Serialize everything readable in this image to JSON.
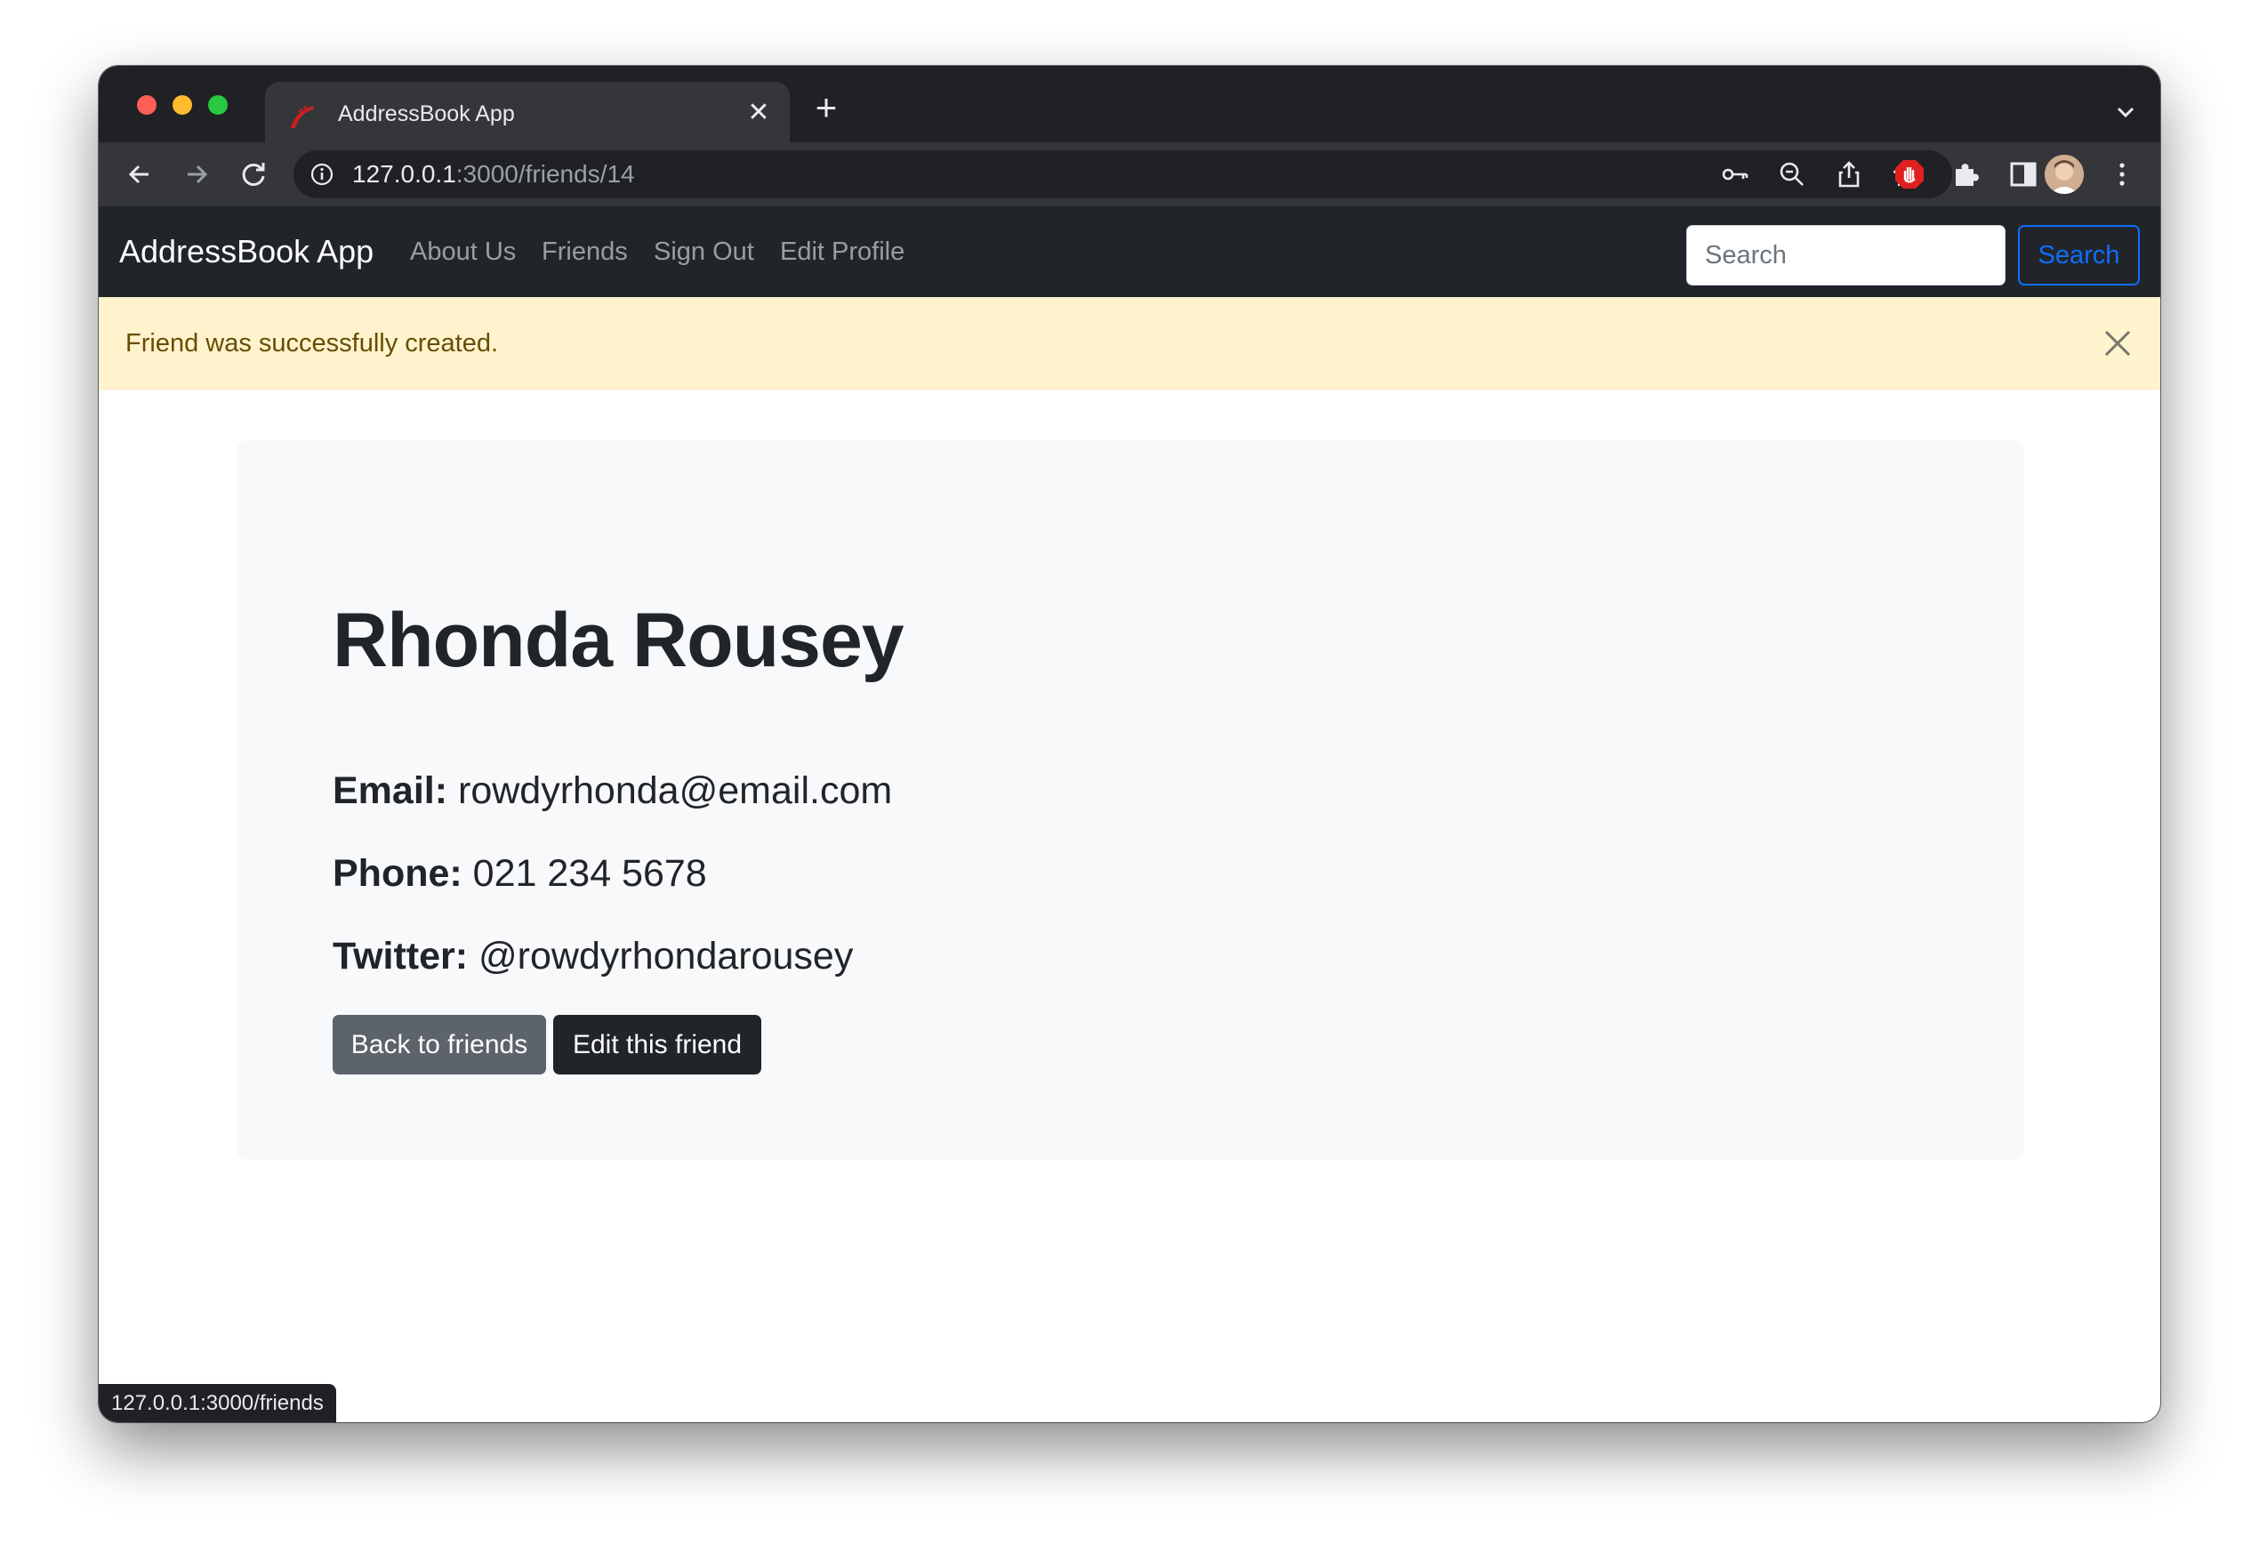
{
  "browser": {
    "tab_title": "AddressBook App",
    "url_host": "127.0.0.1",
    "url_path": ":3000/friends/14",
    "status_url": "127.0.0.1:3000/friends"
  },
  "navbar": {
    "brand": "AddressBook App",
    "links": [
      "About Us",
      "Friends",
      "Sign Out",
      "Edit Profile"
    ],
    "search_placeholder": "Search",
    "search_button": "Search"
  },
  "alert": {
    "message": "Friend was successfully created."
  },
  "friend": {
    "name": "Rhonda Rousey",
    "email_label": "Email:",
    "email": "rowdyrhonda@email.com",
    "phone_label": "Phone:",
    "phone": "021 234 5678",
    "twitter_label": "Twitter:",
    "twitter": "@rowdyrhondarousey"
  },
  "actions": {
    "back": "Back to friends",
    "edit": "Edit this friend"
  },
  "icons": {
    "favicon": "rails-favicon",
    "close_tab": "close-icon",
    "new_tab": "plus-icon",
    "back": "arrow-left-icon",
    "forward": "arrow-right-icon",
    "reload": "reload-icon",
    "info": "info-icon",
    "key": "key-icon",
    "zoom": "zoom-out-icon",
    "share": "share-icon",
    "bookmark": "star-icon",
    "adblock": "adblock-icon",
    "extensions": "puzzle-icon",
    "sidepanel": "side-panel-icon",
    "menu": "kebab-menu-icon"
  },
  "colors": {
    "navbar_bg": "#212529",
    "alert_bg": "#fff3cd",
    "alert_text": "#664d03",
    "primary": "#0d6efd",
    "secondary_btn": "#5c636a",
    "dark_btn": "#212529"
  }
}
